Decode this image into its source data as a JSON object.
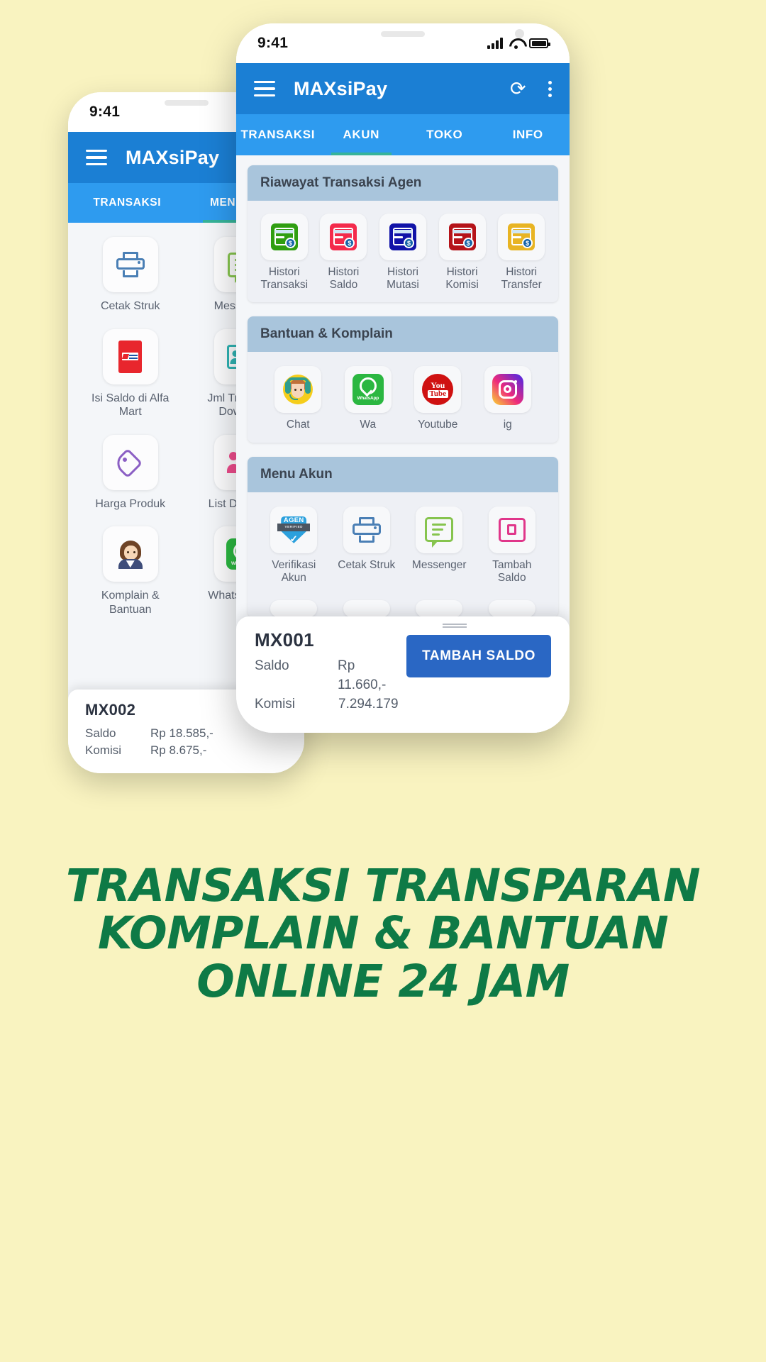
{
  "status_bar": {
    "time": "9:41",
    "icons": [
      "signal-icon",
      "wifi-icon",
      "battery-icon"
    ]
  },
  "front_phone": {
    "app_bar": {
      "menu_icon": "hamburger-icon",
      "title": "MAXsiPay",
      "refresh_icon": "refresh-icon",
      "more_icon": "kebab-menu-icon"
    },
    "tabs": [
      {
        "label": "TRANSAKSI",
        "active": false
      },
      {
        "label": "AKUN",
        "active": true
      },
      {
        "label": "TOKO",
        "active": false
      },
      {
        "label": "INFO",
        "active": false
      }
    ],
    "sections": [
      {
        "title": "Riawayat Transaksi Agen",
        "items": [
          {
            "label": "Histori Transaksi",
            "icon": "credit-card-clock-green-icon",
            "color": "#2f9e11"
          },
          {
            "label": "Histori Saldo",
            "icon": "credit-card-clock-red-icon",
            "color": "#f42a4b"
          },
          {
            "label": "Histori Mutasi",
            "icon": "credit-card-clock-blue-icon",
            "color": "#1113a8"
          },
          {
            "label": "Histori Komisi",
            "icon": "credit-card-clock-darkred-icon",
            "color": "#b51319"
          },
          {
            "label": "Histori Transfer",
            "icon": "credit-card-clock-yellow-icon",
            "color": "#e8b423"
          }
        ]
      },
      {
        "title": "Bantuan & Komplain",
        "items": [
          {
            "label": "Chat",
            "icon": "support-agent-icon"
          },
          {
            "label": "Wa",
            "icon": "whatsapp-icon"
          },
          {
            "label": "Youtube",
            "icon": "youtube-icon"
          },
          {
            "label": "ig",
            "icon": "instagram-icon"
          }
        ]
      },
      {
        "title": "Menu Akun",
        "items": [
          {
            "label": "Verifikasi Akun",
            "icon": "agen-verified-badge-icon"
          },
          {
            "label": "Cetak Struk",
            "icon": "printer-icon"
          },
          {
            "label": "Messenger",
            "icon": "message-lines-icon"
          },
          {
            "label": "Tambah Saldo",
            "icon": "add-balance-card-icon"
          }
        ]
      }
    ],
    "bottom_sheet": {
      "grip_icon": "drag-handle-icon",
      "code": "MX001",
      "rows": [
        {
          "key": "Saldo",
          "value": "Rp 11.660,-"
        },
        {
          "key": "Komisi",
          "value": "7.294.179"
        }
      ],
      "button": "TAMBAH SALDO"
    }
  },
  "back_phone": {
    "app_bar": {
      "menu_icon": "hamburger-icon",
      "title": "MAXsiPay"
    },
    "tabs": [
      {
        "label": "TRANSAKSI",
        "active": false
      },
      {
        "label": "MENU AGEN",
        "active": true
      }
    ],
    "menu_items": [
      {
        "label": "Cetak Struk",
        "icon": "printer-icon"
      },
      {
        "label": "Messenger",
        "icon": "message-lines-icon"
      },
      {
        "label": "Isi Saldo di Alfa Mart",
        "icon": "alfamart-icon"
      },
      {
        "label": "Jml Transaksi Downline",
        "icon": "contact-stats-icon"
      },
      {
        "label": "Harga Produk",
        "icon": "price-tag-icon"
      },
      {
        "label": "List Downline",
        "icon": "people-group-icon"
      },
      {
        "label": "Komplain & Bantuan",
        "icon": "support-woman-icon"
      },
      {
        "label": "Whatsapp Cs",
        "icon": "whatsapp-icon"
      }
    ],
    "bottom_sheet": {
      "grip_icon": "drag-handle-icon",
      "code": "MX002",
      "rows": [
        {
          "key": "Saldo",
          "value": "Rp 18.585,-"
        },
        {
          "key": "Komisi",
          "value": "Rp 8.675,-"
        }
      ],
      "button": ""
    }
  },
  "headline": {
    "line1": "TRANSAKSI TRANSPARAN",
    "line2": "KOMPLAIN & BANTUAN",
    "line3": "ONLINE 24 JAM",
    "color": "#0e7a46"
  }
}
